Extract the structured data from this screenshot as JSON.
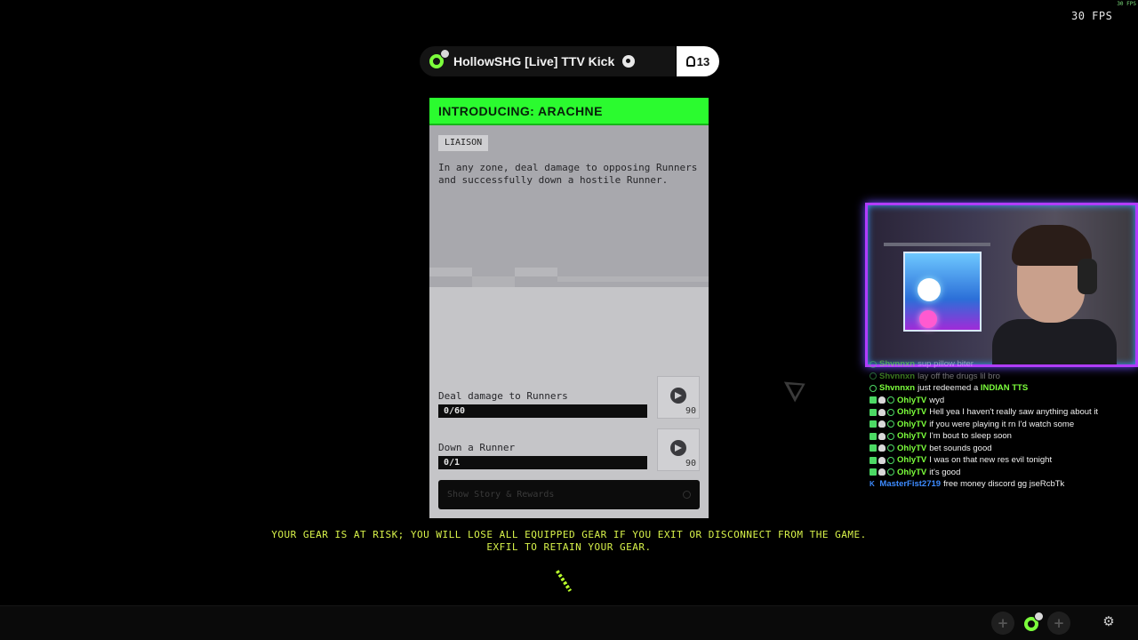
{
  "overlay": {
    "fps_small": "30 FPS",
    "fps": "30 FPS"
  },
  "player": {
    "name": "HollowSHG [Live] TTV Kick",
    "count": "13",
    "icon": "player-avatar-icon",
    "platform_icon": "steam-icon"
  },
  "contract": {
    "title": "INTRODUCING: ARACHNE",
    "tag": "LIAISON",
    "description": "In any zone, deal damage to opposing Runners and successfully down a hostile Runner.",
    "accent_color": "#2bfb2f",
    "objectives": [
      {
        "label": "Deal damage to Runners",
        "progress": "0/60",
        "reward": "90"
      },
      {
        "label": "Down a Runner",
        "progress": "0/1",
        "reward": "90"
      }
    ],
    "story_button": "Show Story & Rewards"
  },
  "warning": {
    "line1": "YOUR GEAR IS AT RISK; YOU WILL LOSE ALL EQUIPPED GEAR IF YOU EXIT OR DISCONNECT FROM THE GAME.",
    "line2": "EXFIL TO RETAIN YOUR GEAR.",
    "color": "#d8f24a"
  },
  "chat": [
    {
      "user": "Shvnnxn",
      "text": "sup pillow biter",
      "faded": true
    },
    {
      "user": "Shvnnxn",
      "text": "lay off the drugs lil bro",
      "faded": true
    },
    {
      "user": "Shvnnxn",
      "text": "just redeemed a",
      "highlight": "INDIAN TTS"
    },
    {
      "user": "OhlyTV",
      "text": "wyd"
    },
    {
      "user": "OhlyTV",
      "text": "Hell yea I haven't really saw anything about it"
    },
    {
      "user": "OhlyTV",
      "text": "if you were playing it rn I'd watch some"
    },
    {
      "user": "OhlyTV",
      "text": "I'm bout to sleep soon"
    },
    {
      "user": "OhlyTV",
      "text": "bet sounds good"
    },
    {
      "user": "OhlyTV",
      "text": "I was on that new res evil tonight"
    },
    {
      "user": "OhlyTV",
      "text": "it's good"
    },
    {
      "user": "MasterFist2719",
      "text": "free money discord gg jseRcbTk"
    }
  ],
  "bottom_bar": {
    "left_slot": "+",
    "right_slot": "+",
    "settings_icon": "gear-icon"
  }
}
